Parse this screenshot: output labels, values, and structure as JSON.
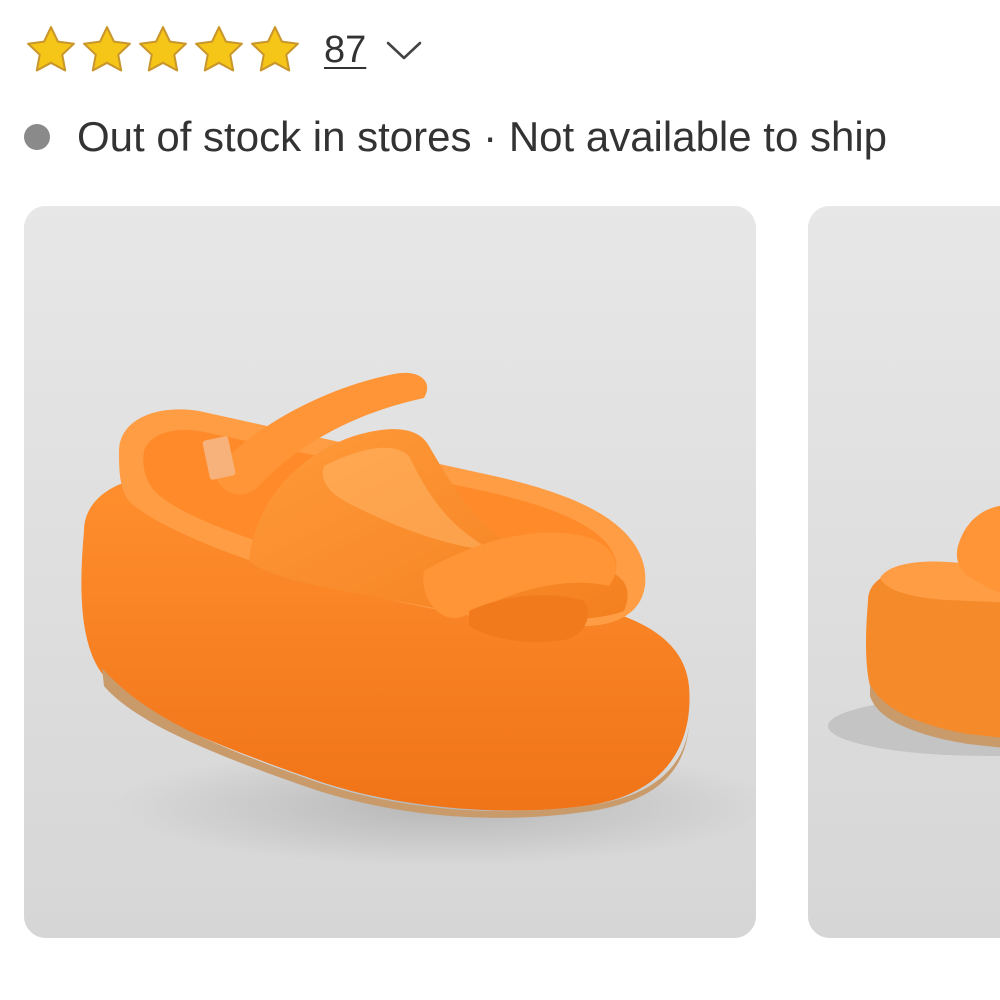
{
  "rating": {
    "stars": 5,
    "max_stars": 5,
    "star_color": "#F5C518",
    "star_outline": "#C8962B",
    "count": "87",
    "expand_icon": "chevron-down-icon"
  },
  "availability": {
    "status_color": "#8A8A8A",
    "text": "Out of stock in stores · Not available to ship"
  },
  "gallery": {
    "accent_color": "#F58A2A",
    "images": [
      {
        "name": "product-image-primary",
        "description_icon": "orange-platform-slide-sandal"
      },
      {
        "name": "product-image-secondary",
        "description_icon": "orange-platform-slide-sandal"
      }
    ]
  }
}
